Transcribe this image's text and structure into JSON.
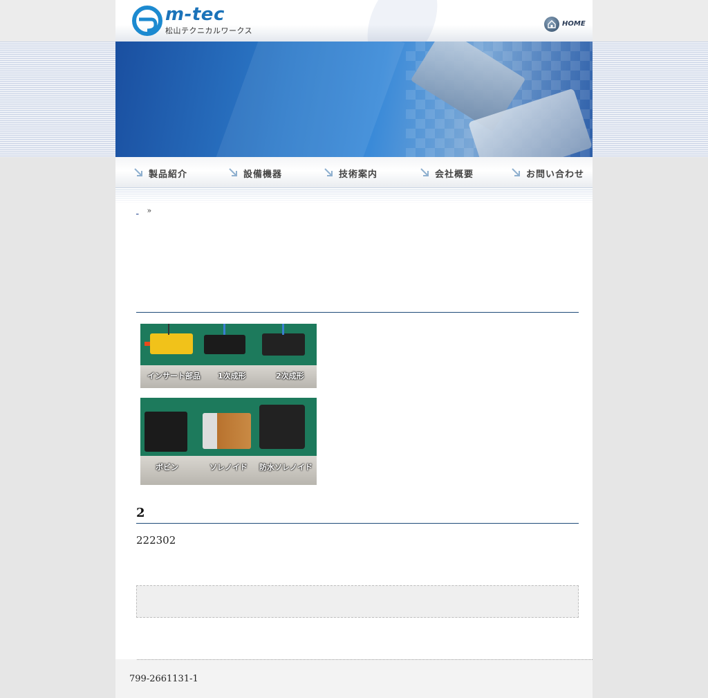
{
  "header": {
    "logo_text": "m-tec",
    "logo_sub": "松山テクニカルワークス",
    "home_label": "HOME"
  },
  "nav": {
    "items": [
      {
        "label": "製品紹介"
      },
      {
        "label": "設備機器"
      },
      {
        "label": "技術案内"
      },
      {
        "label": "会社概要"
      },
      {
        "label": "お問い合わせ"
      }
    ]
  },
  "breadcrumb": {
    "link_label": "",
    "separator": "»"
  },
  "photos": {
    "first_captions": [
      "インサート部品",
      "1次成形",
      "2次成形"
    ],
    "second_captions": [
      "ボビン",
      "ソレノイド",
      "防水ソレノイド"
    ]
  },
  "section": {
    "heading": "2",
    "body": "222302"
  },
  "footer": {
    "text": "799-2661131-1"
  },
  "colors": {
    "accent": "#1d4a78",
    "logo_blue": "#1c73b9",
    "photo_bg": "#1d7a5c"
  }
}
